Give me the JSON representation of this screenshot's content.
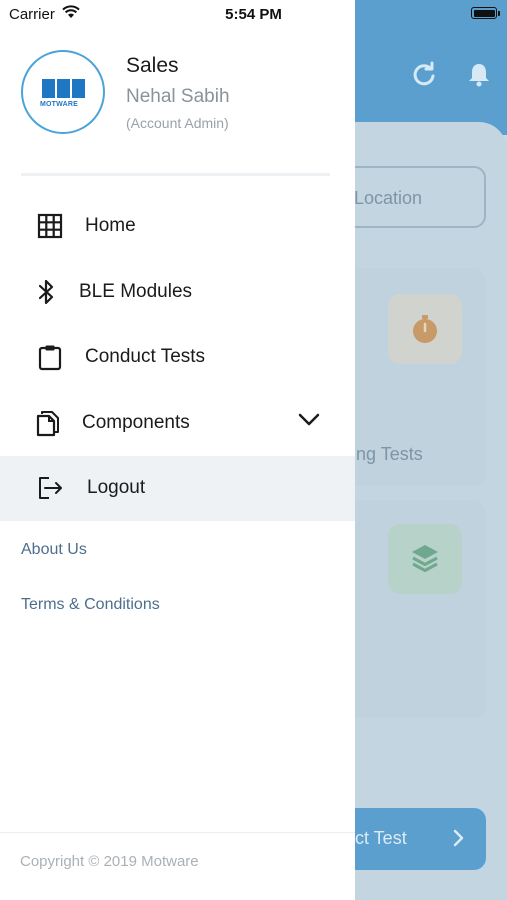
{
  "status_bar": {
    "carrier": "Carrier",
    "time": "5:54 PM"
  },
  "profile": {
    "role": "Sales",
    "name": "Nehal Sabih",
    "account_type": "(Account Admin)",
    "logo_text": "MOTWARE"
  },
  "menu": [
    {
      "label": "Home",
      "icon": "grid-icon"
    },
    {
      "label": "BLE Modules",
      "icon": "bluetooth-icon"
    },
    {
      "label": "Conduct Tests",
      "icon": "clipboard-icon"
    },
    {
      "label": "Components",
      "icon": "document-icon",
      "expandable": true
    },
    {
      "label": "Logout",
      "icon": "logout-icon",
      "active": true
    }
  ],
  "links": {
    "about": "About Us",
    "terms": "Terms & Conditions"
  },
  "footer": {
    "copyright": "Copyright © 2019 Motware"
  },
  "background": {
    "location_label": "Location",
    "card_label": "ing Tests",
    "button_label": "ct Test"
  },
  "colors": {
    "accent": "#4aa3d9",
    "brand": "#1f76c2",
    "header_blue": "#5b9fcf",
    "link": "#4e6e8e",
    "active_bg": "#eef2f5"
  }
}
